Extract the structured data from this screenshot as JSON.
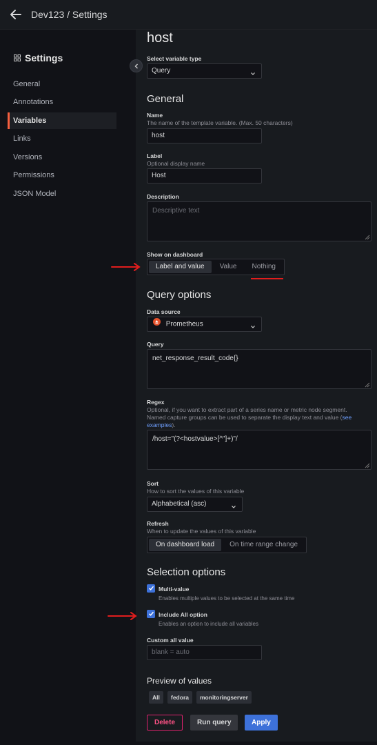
{
  "header": {
    "breadcrumb": "Dev123 / Settings"
  },
  "sidebar": {
    "title": "Settings",
    "items": [
      {
        "label": "General"
      },
      {
        "label": "Annotations"
      },
      {
        "label": "Variables"
      },
      {
        "label": "Links"
      },
      {
        "label": "Versions"
      },
      {
        "label": "Permissions"
      },
      {
        "label": "JSON Model"
      }
    ]
  },
  "editor": {
    "variable_name_heading": "host",
    "type": {
      "label": "Select variable type",
      "value": "Query"
    },
    "general": {
      "heading": "General",
      "name": {
        "label": "Name",
        "description": "The name of the template variable. (Max. 50 characters)",
        "value": "host"
      },
      "display_label": {
        "label": "Label",
        "description": "Optional display name",
        "value": "Host"
      },
      "description": {
        "label": "Description",
        "placeholder": "Descriptive text"
      },
      "show_on_dashboard": {
        "label": "Show on dashboard",
        "options": [
          "Label and value",
          "Value",
          "Nothing"
        ],
        "selected": "Label and value"
      }
    },
    "query_options": {
      "heading": "Query options",
      "data_source": {
        "label": "Data source",
        "value": "Prometheus"
      },
      "query": {
        "label": "Query",
        "value": "net_response_result_code{}"
      },
      "regex": {
        "label": "Regex",
        "description": "Optional, if you want to extract part of a series name or metric node segment. Named capture groups can be used to separate the display text and value (",
        "link_text": "see examples",
        "description_end": ").",
        "value": "/host=\"(?<hostvalue>[^\"]+)\"/"
      },
      "sort": {
        "label": "Sort",
        "description": "How to sort the values of this variable",
        "value": "Alphabetical (asc)"
      },
      "refresh": {
        "label": "Refresh",
        "description": "When to update the values of this variable",
        "options": [
          "On dashboard load",
          "On time range change"
        ],
        "selected": "On dashboard load"
      }
    },
    "selection_options": {
      "heading": "Selection options",
      "multi_value": {
        "label": "Multi-value",
        "description": "Enables multiple values to be selected at the same time",
        "checked": true
      },
      "include_all": {
        "label": "Include All option",
        "description": "Enables an option to include all variables",
        "checked": true
      },
      "custom_all_value": {
        "label": "Custom all value",
        "placeholder": "blank = auto"
      }
    },
    "preview": {
      "heading": "Preview of values",
      "values": [
        "All",
        "fedora",
        "monitoringserver"
      ]
    },
    "buttons": {
      "delete": "Delete",
      "run_query": "Run query",
      "apply": "Apply"
    }
  },
  "colors": {
    "accent": "#3d71d9",
    "active_marker": "#f55f3e",
    "annotation_red": "#e11d1d",
    "danger": "#e0226e"
  }
}
